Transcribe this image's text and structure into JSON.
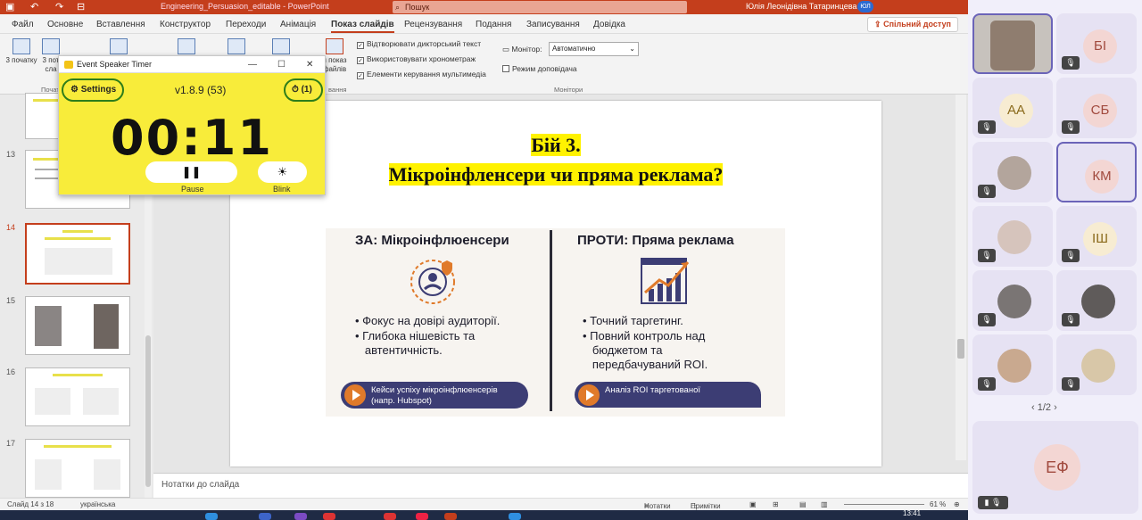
{
  "titlebar": {
    "filename": "Engineering_Persuasion_editable  -  PowerPoint",
    "search_placeholder": "Пошук",
    "user": "Юлія Леонідівна Татаринцева",
    "user_badge": "ЮЛ"
  },
  "menu": {
    "tabs": [
      "Файл",
      "Основне",
      "Вставлення",
      "Конструктор",
      "Переходи",
      "Анімація",
      "Показ слайдів",
      "Рецензування",
      "Подання",
      "Записування",
      "Довідка"
    ],
    "active_tab": "Показ слайдів",
    "share": "Спільний доступ"
  },
  "ribbon": {
    "btn_from_start": "3 початку",
    "btn_from_current": "3 пот сла",
    "btn_show_from": "и показ файлів",
    "group_start": "Почат",
    "group_setup": "вання",
    "group_monitors": "Монітори",
    "chk_narration": "Відтворювати дикторський текст",
    "chk_timings": "Використовувати хронометраж",
    "chk_media": "Елементи керування мультимедіа",
    "monitor_label": "Монітор:",
    "monitor_value": "Автоматично",
    "presenter_view": "Режим доповідача"
  },
  "timer": {
    "window_title": "Event Speaker Timer",
    "settings": "Settings",
    "version": "v1.8.9 (53)",
    "counter": "(1)",
    "time": "00:11",
    "pause": "Pause",
    "blink": "Blink"
  },
  "slides": {
    "numbers": [
      "13",
      "14",
      "15",
      "16",
      "17"
    ],
    "selected": "14"
  },
  "slide": {
    "title_line1": "Бій 3.",
    "title_line2": "Мікроінфленсери чи пряма реклама?",
    "left_head": "ЗА: Мікроінфлюенсери",
    "left_bullets": [
      "• Фокус на довірі аудиторії.",
      "• Глибока нішевість та\n   автентичність."
    ],
    "left_pill": "Кейси успіху мікроінфлюенсерів\n(напр. Hubspot)",
    "right_head": "ПРОТИ: Пряма реклама",
    "right_bullets": [
      "• Точний таргетинг.",
      "• Повний контроль над\n   бюджетом та\n   передбачуваний ROI."
    ],
    "right_pill": "Аналіз ROI таргетованої"
  },
  "notes_placeholder": "Нотатки до слайда",
  "status": {
    "slide_of": "Слайд 14 з 18",
    "language": "українська",
    "notes": "Нотатки",
    "comments": "Примітки",
    "zoom": "61 %",
    "time": "13:41"
  },
  "video": {
    "participants": [
      "БІ",
      "АА",
      "СБ",
      "КМ",
      "ІШ",
      "ЕФ"
    ],
    "page": "1/2"
  },
  "colors": {
    "accent": "#c43e1c",
    "timer_bg": "#f8ec3a",
    "highlight": "#fff200"
  }
}
